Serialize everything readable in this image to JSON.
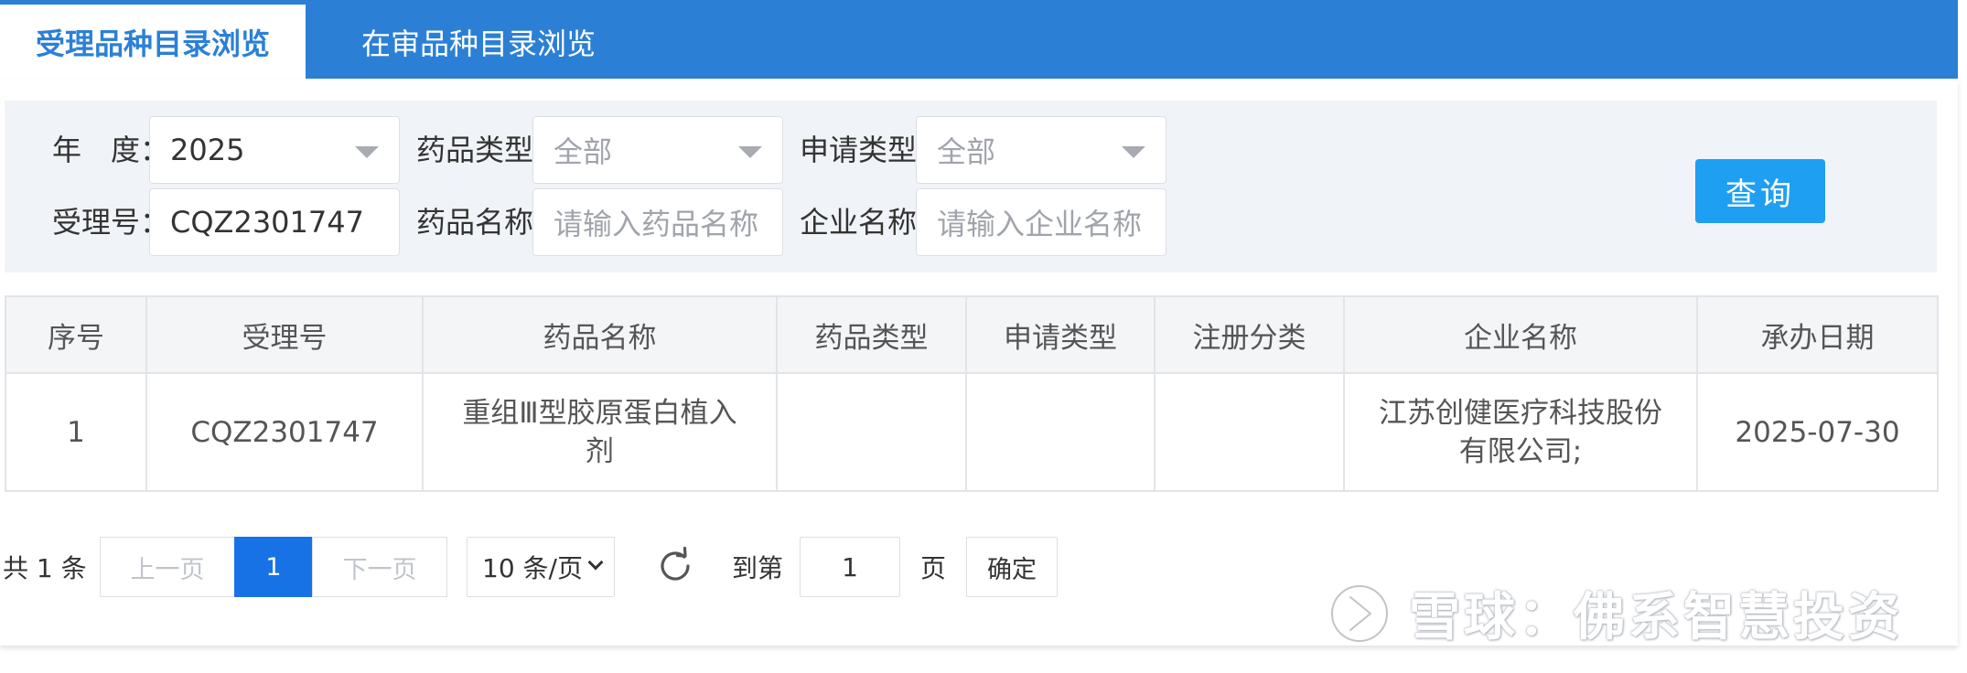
{
  "tabs": [
    {
      "label": "受理品种目录浏览",
      "active": true
    },
    {
      "label": "在审品种目录浏览",
      "active": false
    }
  ],
  "filters": {
    "year": {
      "label": "年　度：",
      "value": "2025"
    },
    "drug_type": {
      "label": "药品类型：",
      "value": "全部"
    },
    "apply_type": {
      "label": "申请类型：",
      "value": "全部"
    },
    "accept_no": {
      "label": "受理号：",
      "value": "CQZ2301747"
    },
    "drug_name": {
      "label": "药品名称：",
      "placeholder": "请输入药品名称"
    },
    "company_name": {
      "label": "企业名称：",
      "placeholder": "请输入企业名称"
    },
    "query_button": "查询"
  },
  "table": {
    "columns": [
      "序号",
      "受理号",
      "药品名称",
      "药品类型",
      "申请类型",
      "注册分类",
      "企业名称",
      "承办日期"
    ],
    "rows": [
      [
        "1",
        "CQZ2301747",
        "重组Ⅲ型胶原蛋白植入剂",
        "",
        "",
        "",
        "江苏创健医疗科技股份有限公司;",
        "2025-07-30"
      ]
    ]
  },
  "pagination": {
    "total_text": "共 1 条",
    "prev_label": "上一页",
    "current_page": "1",
    "next_label": "下一页",
    "page_size": "10 条/页",
    "goto_label": "到第",
    "goto_value": "1",
    "page_unit": "页",
    "confirm_label": "确定"
  },
  "watermark": {
    "text": "雪球：佛系智慧投资",
    "icon": "snowball-logo-icon"
  },
  "colors": {
    "tab_bar": "#2b80d6",
    "query_button": "#1f9ff2",
    "current_page": "#1772e6",
    "filter_bg": "#f0f3f7",
    "header_bg": "#f4f5f7"
  }
}
